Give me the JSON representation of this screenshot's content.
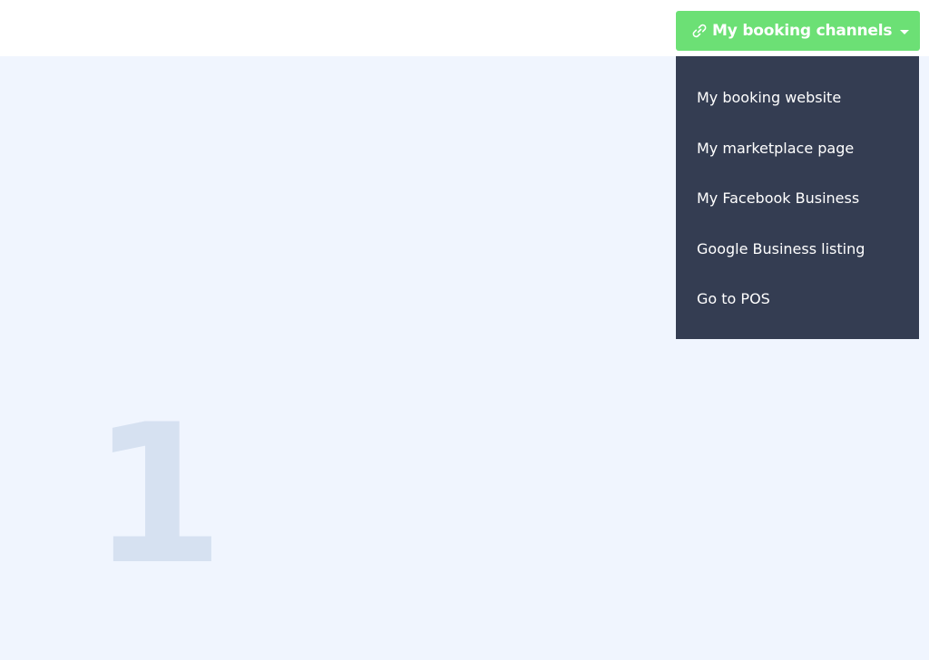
{
  "header": {
    "channels_button": {
      "label": "My booking channels",
      "icon": "link-icon",
      "caret": "caret-down-icon",
      "color": "#6ce075"
    }
  },
  "dropdown": {
    "background": "#343d52",
    "items": [
      {
        "label": "My booking website"
      },
      {
        "label": "My marketplace page"
      },
      {
        "label": "My Facebook Business"
      },
      {
        "label": "Google Business listing"
      },
      {
        "label": "Go to POS"
      }
    ]
  },
  "main": {
    "step_number": "1"
  }
}
